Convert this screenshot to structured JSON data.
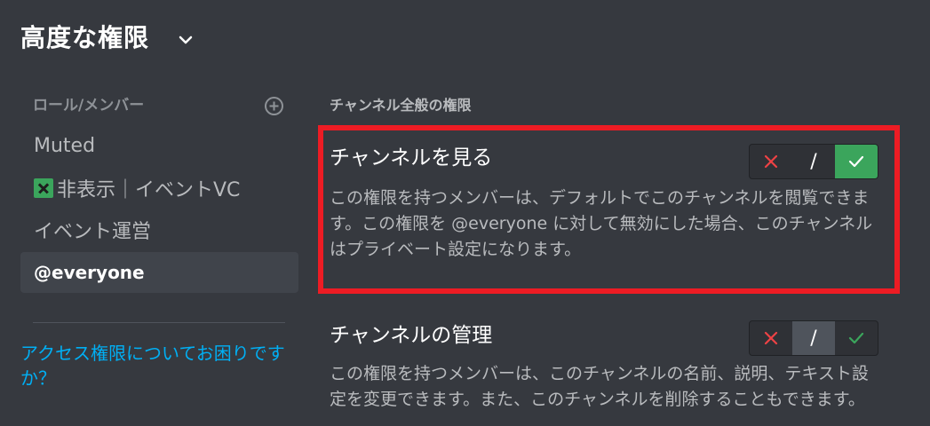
{
  "header": {
    "title": "高度な権限"
  },
  "sidebar": {
    "heading": "ロール/メンバー",
    "items": [
      {
        "label": "Muted",
        "selected": false
      },
      {
        "label": "非表示｜イベントVC",
        "selected": false,
        "prefix_icon": "green-x-box-icon"
      },
      {
        "label": "イベント運営",
        "selected": false
      },
      {
        "label": "@everyone",
        "selected": true
      }
    ],
    "help_link": "アクセス権限についてお困りですか？"
  },
  "main": {
    "section_heading": "チャンネル全般の権限",
    "permissions": [
      {
        "title": "チャンネルを見る",
        "description": "この権限を持つメンバーは、デフォルトでこのチャンネルを閲覧できます。この権限を @everyone に対して無効にした場合、このチャンネルはプライベート設定になります。",
        "state": "allow",
        "highlighted": true
      },
      {
        "title": "チャンネルの管理",
        "description": "この権限を持つメンバーは、このチャンネルの名前、説明、テキスト設定を変更できます。また、このチャンネルを削除することもできます。",
        "state": "neutral",
        "highlighted": false
      }
    ],
    "toggle_labels": {
      "neutral": "/"
    }
  },
  "colors": {
    "background": "#36393f",
    "accent_allow": "#3ba55c",
    "accent_deny": "#ed4245",
    "link": "#00aff4",
    "highlight_box": "#ed1c24"
  }
}
